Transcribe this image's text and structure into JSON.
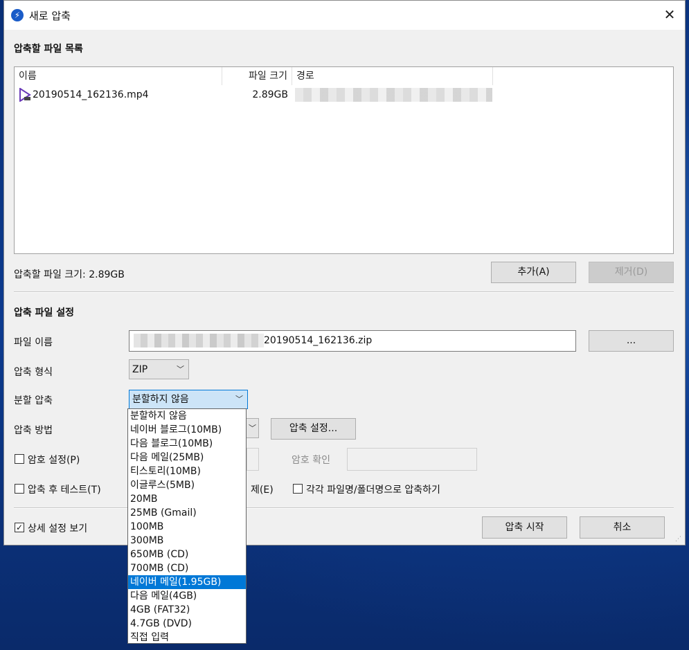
{
  "window": {
    "title": "새로 압축",
    "close": "✕",
    "app_icon": "⚡"
  },
  "file_list": {
    "section_title": "압축할 파일 목록",
    "columns": {
      "name": "이름",
      "size": "파일 크기",
      "path": "경로"
    },
    "rows": [
      {
        "name": "20190514_162136.mp4",
        "size": "2.89GB",
        "icon": "video-file-icon"
      }
    ],
    "total_size_label": "압축할 파일 크기: 2.89GB",
    "add_button": "추가(A)",
    "remove_button": "제거(D)"
  },
  "settings": {
    "section_title": "압축 파일 설정",
    "filename_label": "파일 이름",
    "filename_value": "20190514_162136.zip",
    "browse_button": "...",
    "format_label": "압축 형식",
    "format_value": "ZIP",
    "split_label": "분할 압축",
    "split_value": "분할하지 않음",
    "method_label": "압축 방법",
    "settings_button": "압축 설정...",
    "password_label": "암호 설정(P)",
    "password_confirm_label": "암호 확인",
    "test_label": "압축 후 테스트(T)",
    "delete_label_partial": "제(E)",
    "each_label": "각각 파일명/폴더명으로 압축하기",
    "detail_label": "상세 설정 보기",
    "detail_checked": "✓",
    "start_button": "압축 시작",
    "cancel_button": "취소"
  },
  "split_options": [
    "분할하지 않음",
    "네이버 블로그(10MB)",
    "다음 블로그(10MB)",
    "다음 메일(25MB)",
    "티스토리(10MB)",
    "이글루스(5MB)",
    "20MB",
    "25MB (Gmail)",
    "100MB",
    "300MB",
    "650MB (CD)",
    "700MB (CD)",
    "네이버 메일(1.95GB)",
    "다음 메일(4GB)",
    "4GB (FAT32)",
    "4.7GB (DVD)",
    "직접 입력"
  ],
  "split_highlighted": "네이버 메일(1.95GB)"
}
